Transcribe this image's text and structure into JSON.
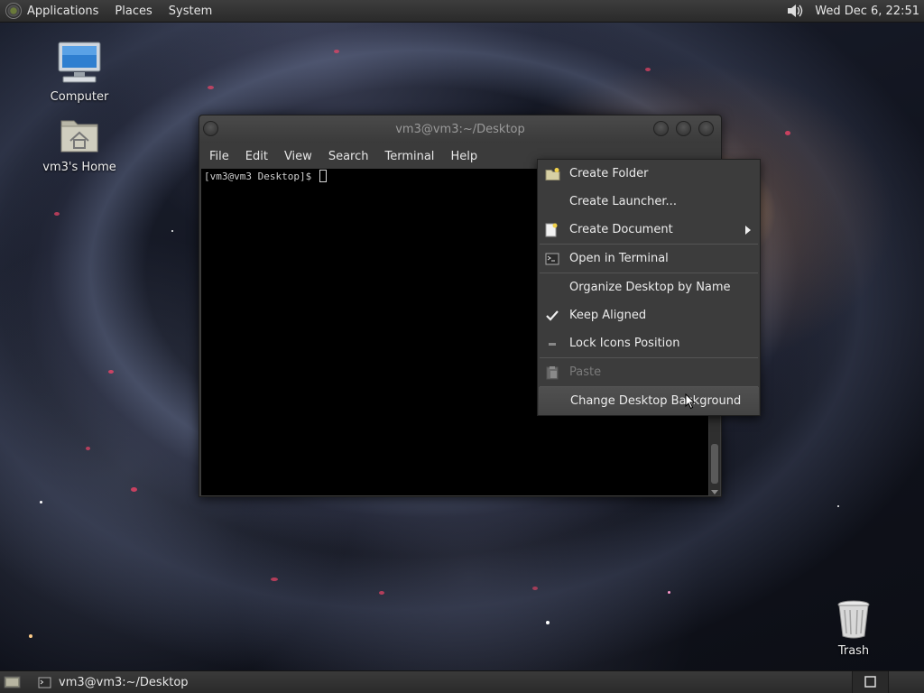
{
  "top_panel": {
    "menus": [
      "Applications",
      "Places",
      "System"
    ],
    "clock": "Wed Dec 6, 22:51"
  },
  "desktop_icons": {
    "computer": "Computer",
    "home": "vm3's Home",
    "trash": "Trash"
  },
  "terminal": {
    "title": "vm3@vm3:~/Desktop",
    "menus": [
      "File",
      "Edit",
      "View",
      "Search",
      "Terminal",
      "Help"
    ],
    "prompt": "[vm3@vm3 Desktop]$ "
  },
  "context_menu": {
    "items": [
      {
        "label": "Create Folder",
        "icon": "folder-new-icon"
      },
      {
        "label": "Create Launcher...",
        "icon": ""
      },
      {
        "label": "Create Document",
        "icon": "document-new-icon",
        "submenu": true
      },
      {
        "label": "Open in Terminal",
        "icon": "terminal-icon"
      },
      {
        "label": "Organize Desktop by Name",
        "icon": ""
      },
      {
        "label": "Keep Aligned",
        "icon": "check-icon",
        "checked": true
      },
      {
        "label": "Lock Icons Position",
        "icon": "unchecked-dash-icon"
      },
      {
        "label": "Paste",
        "icon": "paste-icon",
        "disabled": true
      },
      {
        "label": "Change Desktop Background",
        "icon": "",
        "highlighted": true
      }
    ]
  },
  "bottom_panel": {
    "task_label": "vm3@vm3:~/Desktop"
  },
  "colors": {
    "panel": "#333333",
    "menu_bg": "#3c3c3c",
    "menu_highlight": "#4a4a4a",
    "terminal_bg": "#000000"
  }
}
